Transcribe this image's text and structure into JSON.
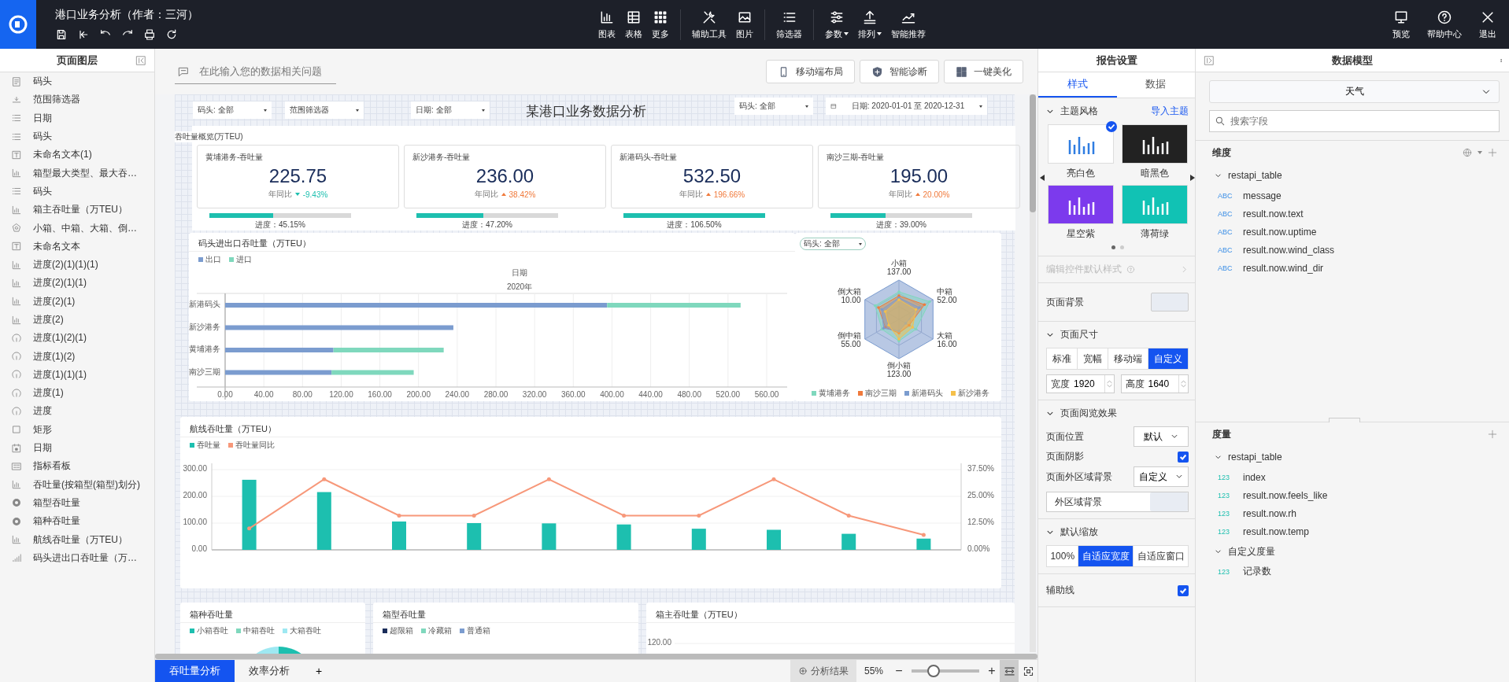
{
  "app": {
    "title": "港口业务分析（作者：三河）",
    "quick_actions": [
      {
        "kind": "save"
      },
      {
        "kind": "first"
      },
      {
        "kind": "undo"
      },
      {
        "kind": "redo"
      },
      {
        "kind": "print"
      },
      {
        "kind": "refresh"
      }
    ],
    "toolbar": [
      {
        "label": "图表",
        "kind": "chart",
        "separated": false,
        "dropdown": false
      },
      {
        "label": "表格",
        "kind": "table",
        "separated": false,
        "dropdown": false
      },
      {
        "label": "更多",
        "kind": "more",
        "separated": false,
        "dropdown": false
      },
      {
        "label": "辅助工具",
        "kind": "tools",
        "separated": true,
        "dropdown": false
      },
      {
        "label": "图片",
        "kind": "image",
        "separated": false,
        "dropdown": false
      },
      {
        "label": "筛选器",
        "kind": "filter",
        "separated": true,
        "dropdown": false
      },
      {
        "label": "参数",
        "kind": "params",
        "separated": true,
        "dropdown": true
      },
      {
        "label": "排列",
        "kind": "arrange",
        "separated": false,
        "dropdown": true
      },
      {
        "label": "智能推荐",
        "kind": "smart",
        "separated": false,
        "dropdown": false
      }
    ],
    "right_actions": [
      {
        "label": "预览",
        "kind": "preview"
      },
      {
        "label": "帮助中心",
        "kind": "help"
      },
      {
        "label": "退出",
        "kind": "exit"
      }
    ]
  },
  "layers": {
    "title": "页面图层",
    "items": [
      {
        "label": "码头",
        "kind": "doc"
      },
      {
        "label": "范围筛选器",
        "kind": "range"
      },
      {
        "label": "日期",
        "kind": "list"
      },
      {
        "label": "码头",
        "kind": "list"
      },
      {
        "label": "未命名文本(1)",
        "kind": "textbox"
      },
      {
        "label": "箱型最大类型、最大吞…",
        "kind": "bar"
      },
      {
        "label": "码头",
        "kind": "list"
      },
      {
        "label": "箱主吞吐量（万TEU）",
        "kind": "bar"
      },
      {
        "label": "小箱、中箱、大箱、倒…",
        "kind": "radar"
      },
      {
        "label": "未命名文本",
        "kind": "textbox"
      },
      {
        "label": "进度(2)(1)(1)(1)",
        "kind": "bar"
      },
      {
        "label": "进度(2)(1)(1)",
        "kind": "bar"
      },
      {
        "label": "进度(2)(1)",
        "kind": "bar"
      },
      {
        "label": "进度(2)",
        "kind": "bar"
      },
      {
        "label": "进度(1)(2)(1)",
        "kind": "gauge"
      },
      {
        "label": "进度(1)(2)",
        "kind": "gauge"
      },
      {
        "label": "进度(1)(1)(1)",
        "kind": "gauge"
      },
      {
        "label": "进度(1)",
        "kind": "gauge"
      },
      {
        "label": "进度",
        "kind": "gauge"
      },
      {
        "label": "矩形",
        "kind": "rect"
      },
      {
        "label": "日期",
        "kind": "date"
      },
      {
        "label": "指标看板",
        "kind": "kpi"
      },
      {
        "label": "吞吐量(按箱型(箱型)划分)",
        "kind": "bar"
      },
      {
        "label": "箱型吞吐量",
        "kind": "donut"
      },
      {
        "label": "箱种吞吐量",
        "kind": "donut"
      },
      {
        "label": "航线吞吐量（万TEU）",
        "kind": "bar"
      },
      {
        "label": "码头进出口吞吐量（万…",
        "kind": "dotbar"
      }
    ]
  },
  "question": {
    "placeholder": "在此输入您的数据相关问题"
  },
  "canvas_actions": [
    {
      "label": "移动端布局",
      "kind": "mobile"
    },
    {
      "label": "智能诊断",
      "kind": "shield"
    },
    {
      "label": "一键美化",
      "kind": "layout"
    }
  ],
  "report": {
    "title": "某港口业务数据分析",
    "filters": [
      {
        "label": "码头: 全部",
        "kind": "select"
      },
      {
        "label": "范围筛选器",
        "kind": "select"
      },
      {
        "label": "日期: 全部",
        "kind": "select"
      },
      {
        "label": "码头: 全部",
        "kind": "select"
      },
      {
        "label": "日期: 2020-01-01 至 2020-12-31",
        "kind": "date"
      }
    ],
    "overview_label": "吞吐量概览(万TEU)",
    "kpis": [
      {
        "name": "黄埔港务-吞吐量",
        "value": "225.75",
        "compare_label": "年同比",
        "change": "-9.43%",
        "increase": false,
        "progress": "进度：45.15%",
        "level": 0.4515
      },
      {
        "name": "新沙港务-吞吐量",
        "value": "236.00",
        "compare_label": "年同比",
        "change": "38.42%",
        "increase": true,
        "progress": "进度：47.20%",
        "level": 0.472
      },
      {
        "name": "新港码头-吞吐量",
        "value": "532.50",
        "compare_label": "年同比",
        "change": "196.66%",
        "increase": true,
        "progress": "进度：106.50%",
        "level": 1
      },
      {
        "name": "南沙三期-吞吐量",
        "value": "195.00",
        "compare_label": "年同比",
        "change": "20.00%",
        "increase": true,
        "progress": "进度：39.00%",
        "level": 0.39
      }
    ],
    "port_chart": {
      "title": "码头进出口吞吐量（万TEU）",
      "header": "日期",
      "subheader": "2020年",
      "chart_data": {
        "type": "bar",
        "orientation": "horizontal",
        "stacked": true,
        "grid": true,
        "categories": [
          "新港码头",
          "新沙港务",
          "黄埔港务",
          "南沙三期"
        ],
        "series": [
          {
            "name": "出口",
            "color": "#7b9ccf",
            "values": [
              395,
              236,
              112,
              110
            ]
          },
          {
            "name": "进口",
            "color": "#7fd8bd",
            "values": [
              138,
              null,
              114,
              85
            ]
          }
        ],
        "xlim": [
          0,
          560
        ],
        "xticks": [
          {
            "value": 0,
            "label": "0.00"
          },
          {
            "value": 40,
            "label": "40.00"
          },
          {
            "value": 80,
            "label": "80.00"
          },
          {
            "value": 120,
            "label": "120.00"
          },
          {
            "value": 160,
            "label": "160.00"
          },
          {
            "value": 200,
            "label": "200.00"
          },
          {
            "value": 240,
            "label": "240.00"
          },
          {
            "value": 280,
            "label": "280.00"
          },
          {
            "value": 320,
            "label": "320.00"
          },
          {
            "value": 360,
            "label": "360.00"
          },
          {
            "value": 400,
            "label": "400.00"
          },
          {
            "value": 440,
            "label": "440.00"
          },
          {
            "value": 480,
            "label": "480.00"
          },
          {
            "value": 520,
            "label": "520.00"
          },
          {
            "value": 560,
            "label": "560.00"
          }
        ]
      }
    },
    "radar": {
      "filter": "码头: 全部",
      "axes": [
        {
          "name": "小箱",
          "value": "137.00"
        },
        {
          "name": "中箱",
          "value": "52.00"
        },
        {
          "name": "大箱",
          "value": "16.00"
        },
        {
          "name": "倒小箱",
          "value": "123.00"
        },
        {
          "name": "倒中箱",
          "value": "55.00"
        },
        {
          "name": "倒大箱",
          "value": "10.00"
        }
      ],
      "legend": [
        {
          "name": "黄埔港务",
          "color": "#7fd8bd"
        },
        {
          "name": "南沙三期",
          "color": "#f07a3c"
        },
        {
          "name": "新港码头",
          "color": "#7b9ccf"
        },
        {
          "name": "新沙港务",
          "color": "#f5c04a"
        }
      ]
    },
    "route_chart": {
      "title": "航线吞吐量（万TEU）",
      "chart_data": {
        "type": "bar",
        "grid": true,
        "series": [
          {
            "name": "吞吐量",
            "color": "#1dbfaf",
            "values": [
              262,
              216,
              106,
              100,
              99,
              95,
              79,
              75,
              60,
              42
            ]
          },
          {
            "name": "吞吐量同比",
            "color": "#f7987a",
            "type": "line",
            "axis": "y2",
            "values": [
              10,
              33,
              16,
              16,
              33,
              16,
              16,
              33,
              16,
              7
            ]
          }
        ],
        "ylim": [
          0,
          300
        ],
        "yticks": [
          {
            "value": 0,
            "label": "0.00"
          },
          {
            "value": 100,
            "label": "100.00"
          },
          {
            "value": 200,
            "label": "200.00"
          },
          {
            "value": 300,
            "label": "300.00"
          }
        ],
        "y2lim": [
          0,
          37.5
        ],
        "y2ticks": [
          {
            "value": 0,
            "label": "0.00%"
          },
          {
            "value": 12.5,
            "label": "12.50%"
          },
          {
            "value": 25,
            "label": "25.00%"
          },
          {
            "value": 37.5,
            "label": "37.50%"
          }
        ]
      }
    },
    "small_charts": [
      {
        "title": "箱种吞吐量",
        "kind": "pie",
        "legend": [
          {
            "name": "小箱吞吐",
            "color": "#1dbfaf"
          },
          {
            "name": "中箱吞吐",
            "color": "#7fd8bd"
          },
          {
            "name": "大箱吞吐",
            "color": "#9ee8f2"
          }
        ]
      },
      {
        "title": "箱型吞吐量",
        "kind": "donut",
        "legend": [
          {
            "name": "超限箱",
            "color": "#1a2d5a"
          },
          {
            "name": "冷藏箱",
            "color": "#7fd8bd"
          },
          {
            "name": "普通箱",
            "color": "#7b9ccf"
          }
        ]
      },
      {
        "title": "箱主吞吐量（万TEU）",
        "kind": "axis",
        "tick": "120.00"
      }
    ]
  },
  "page_tabs": [
    {
      "label": "吞吐量分析",
      "selected": true
    },
    {
      "label": "效率分析",
      "selected": false
    }
  ],
  "add_tab": "+",
  "zoom_bar": {
    "result_label": "分析结果",
    "zoom": "55%",
    "minus": "−",
    "plus": "+",
    "level": 0.33
  },
  "settings": {
    "title": "报告设置",
    "tabs": [
      {
        "label": "样式",
        "selected": true
      },
      {
        "label": "数据",
        "selected": false
      }
    ],
    "theme": {
      "title": "主题风格",
      "link": "导入主题",
      "themes": [
        {
          "name": "亮白色",
          "kind": "light",
          "selected": true
        },
        {
          "name": "暗黑色",
          "kind": "dark",
          "selected": false
        },
        {
          "name": "星空紫",
          "kind": "purple",
          "selected": false
        },
        {
          "name": "薄荷绿",
          "kind": "mint",
          "selected": false
        }
      ],
      "pages": [
        {
          "selected": true
        },
        {
          "selected": false
        }
      ]
    },
    "default_style": {
      "label": "编辑控件默认样式",
      "disabled": true
    },
    "page_background": {
      "label": "页面背景"
    },
    "page_size": {
      "title": "页面尺寸",
      "options": [
        {
          "label": "标准",
          "selected": false
        },
        {
          "label": "宽幅",
          "selected": false
        },
        {
          "label": "移动端",
          "selected": false
        },
        {
          "label": "自定义",
          "selected": true
        }
      ],
      "width": {
        "label": "宽度",
        "value": "1920"
      },
      "height": {
        "label": "高度",
        "value": "1640"
      }
    },
    "view_effect": {
      "title": "页面阅览效果",
      "position": {
        "label": "页面位置",
        "value": "默认"
      },
      "shadow": {
        "label": "页面阴影",
        "checked": true
      },
      "outer": {
        "label": "页面外区域背景",
        "value": "自定义"
      },
      "outer_background": {
        "label": "外区域背景"
      }
    },
    "default_zoom": {
      "title": "默认缩放",
      "options": [
        {
          "label": "100%",
          "selected": false
        },
        {
          "label": "自适应宽度",
          "selected": true
        },
        {
          "label": "自适应窗口",
          "selected": false
        }
      ]
    },
    "guides": {
      "label": "辅助线",
      "checked": true
    }
  },
  "data_model": {
    "title": "数据模型",
    "dataset": "天气",
    "search": {
      "placeholder": "搜索字段"
    },
    "dimensions": {
      "title": "维度",
      "groups": [
        {
          "name": "restapi_table",
          "expanded": true,
          "children": [
            {
              "name": "message",
              "kind": "text",
              "tag": "ABC"
            },
            {
              "name": "result.now.text",
              "kind": "text",
              "tag": "ABC"
            },
            {
              "name": "result.now.uptime",
              "kind": "text",
              "tag": "ABC"
            },
            {
              "name": "result.now.wind_class",
              "kind": "text",
              "tag": "ABC"
            },
            {
              "name": "result.now.wind_dir",
              "kind": "text",
              "tag": "ABC"
            }
          ]
        }
      ]
    },
    "measures": {
      "title": "度量",
      "groups": [
        {
          "name": "restapi_table",
          "expanded": true,
          "children": [
            {
              "name": "index",
              "kind": "number",
              "tag": "123"
            },
            {
              "name": "result.now.feels_like",
              "kind": "number",
              "tag": "123"
            },
            {
              "name": "result.now.rh",
              "kind": "number",
              "tag": "123"
            },
            {
              "name": "result.now.temp",
              "kind": "number",
              "tag": "123"
            }
          ]
        },
        {
          "name": "自定义度量",
          "expanded": true,
          "children": [
            {
              "name": "记录数",
              "kind": "number",
              "tag": "123"
            }
          ]
        }
      ]
    }
  }
}
